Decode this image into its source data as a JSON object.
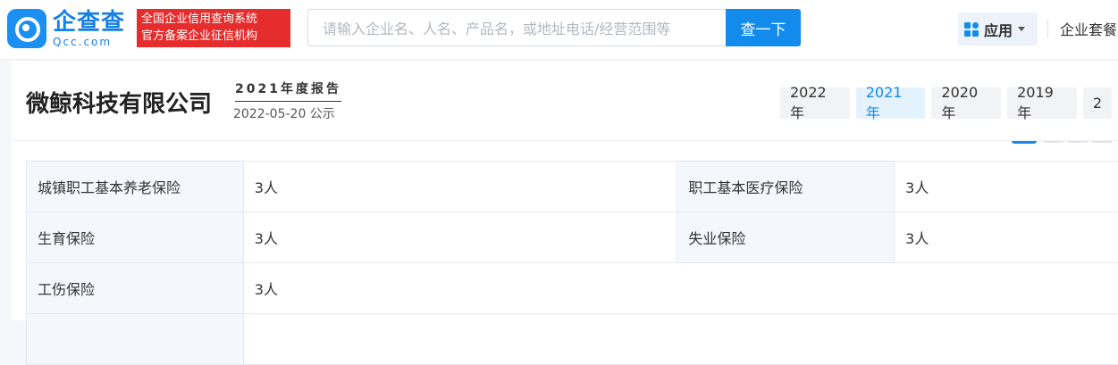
{
  "header": {
    "logo_cn": "企查查",
    "logo_en": "Qcc.com",
    "badge_line1": "全国企业信用查询系统",
    "badge_line2": "官方备案企业征信机构",
    "search_placeholder": "请输入企业名、人名、产品名，或地址电话/经营范围等",
    "search_button": "查一下",
    "apps_label": "应用",
    "suite_label": "企业套餐"
  },
  "report": {
    "company": "微鲸科技有限公司",
    "title": "2021年度报告",
    "date": "2022-05-20 公示",
    "years": [
      "2022年",
      "2021年",
      "2020年",
      "2019年",
      "2"
    ],
    "active_year": "2021年"
  },
  "insurance_table": {
    "rows": [
      [
        "城镇职工基本养老保险",
        "3人",
        "职工基本医疗保险",
        "3人"
      ],
      [
        "生育保险",
        "3人",
        "失业保险",
        "3人"
      ],
      [
        "工伤保险",
        "3人"
      ]
    ]
  },
  "colors": {
    "accent": "#128bed",
    "badge": "#e52d2d"
  }
}
